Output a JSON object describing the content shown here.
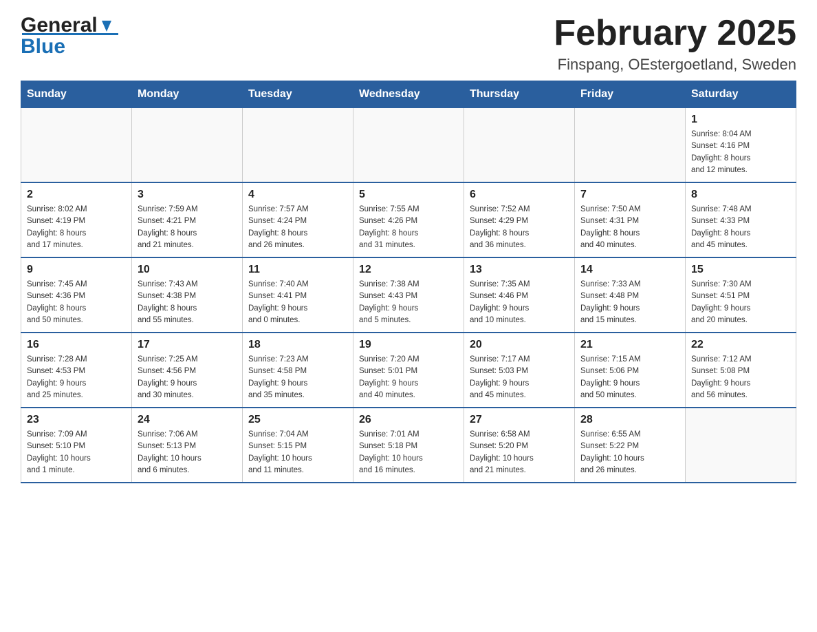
{
  "header": {
    "logo_general": "General",
    "logo_blue": "Blue",
    "month_title": "February 2025",
    "location": "Finspang, OEstergoetland, Sweden"
  },
  "weekdays": [
    "Sunday",
    "Monday",
    "Tuesday",
    "Wednesday",
    "Thursday",
    "Friday",
    "Saturday"
  ],
  "weeks": [
    [
      {
        "day": "",
        "info": ""
      },
      {
        "day": "",
        "info": ""
      },
      {
        "day": "",
        "info": ""
      },
      {
        "day": "",
        "info": ""
      },
      {
        "day": "",
        "info": ""
      },
      {
        "day": "",
        "info": ""
      },
      {
        "day": "1",
        "info": "Sunrise: 8:04 AM\nSunset: 4:16 PM\nDaylight: 8 hours\nand 12 minutes."
      }
    ],
    [
      {
        "day": "2",
        "info": "Sunrise: 8:02 AM\nSunset: 4:19 PM\nDaylight: 8 hours\nand 17 minutes."
      },
      {
        "day": "3",
        "info": "Sunrise: 7:59 AM\nSunset: 4:21 PM\nDaylight: 8 hours\nand 21 minutes."
      },
      {
        "day": "4",
        "info": "Sunrise: 7:57 AM\nSunset: 4:24 PM\nDaylight: 8 hours\nand 26 minutes."
      },
      {
        "day": "5",
        "info": "Sunrise: 7:55 AM\nSunset: 4:26 PM\nDaylight: 8 hours\nand 31 minutes."
      },
      {
        "day": "6",
        "info": "Sunrise: 7:52 AM\nSunset: 4:29 PM\nDaylight: 8 hours\nand 36 minutes."
      },
      {
        "day": "7",
        "info": "Sunrise: 7:50 AM\nSunset: 4:31 PM\nDaylight: 8 hours\nand 40 minutes."
      },
      {
        "day": "8",
        "info": "Sunrise: 7:48 AM\nSunset: 4:33 PM\nDaylight: 8 hours\nand 45 minutes."
      }
    ],
    [
      {
        "day": "9",
        "info": "Sunrise: 7:45 AM\nSunset: 4:36 PM\nDaylight: 8 hours\nand 50 minutes."
      },
      {
        "day": "10",
        "info": "Sunrise: 7:43 AM\nSunset: 4:38 PM\nDaylight: 8 hours\nand 55 minutes."
      },
      {
        "day": "11",
        "info": "Sunrise: 7:40 AM\nSunset: 4:41 PM\nDaylight: 9 hours\nand 0 minutes."
      },
      {
        "day": "12",
        "info": "Sunrise: 7:38 AM\nSunset: 4:43 PM\nDaylight: 9 hours\nand 5 minutes."
      },
      {
        "day": "13",
        "info": "Sunrise: 7:35 AM\nSunset: 4:46 PM\nDaylight: 9 hours\nand 10 minutes."
      },
      {
        "day": "14",
        "info": "Sunrise: 7:33 AM\nSunset: 4:48 PM\nDaylight: 9 hours\nand 15 minutes."
      },
      {
        "day": "15",
        "info": "Sunrise: 7:30 AM\nSunset: 4:51 PM\nDaylight: 9 hours\nand 20 minutes."
      }
    ],
    [
      {
        "day": "16",
        "info": "Sunrise: 7:28 AM\nSunset: 4:53 PM\nDaylight: 9 hours\nand 25 minutes."
      },
      {
        "day": "17",
        "info": "Sunrise: 7:25 AM\nSunset: 4:56 PM\nDaylight: 9 hours\nand 30 minutes."
      },
      {
        "day": "18",
        "info": "Sunrise: 7:23 AM\nSunset: 4:58 PM\nDaylight: 9 hours\nand 35 minutes."
      },
      {
        "day": "19",
        "info": "Sunrise: 7:20 AM\nSunset: 5:01 PM\nDaylight: 9 hours\nand 40 minutes."
      },
      {
        "day": "20",
        "info": "Sunrise: 7:17 AM\nSunset: 5:03 PM\nDaylight: 9 hours\nand 45 minutes."
      },
      {
        "day": "21",
        "info": "Sunrise: 7:15 AM\nSunset: 5:06 PM\nDaylight: 9 hours\nand 50 minutes."
      },
      {
        "day": "22",
        "info": "Sunrise: 7:12 AM\nSunset: 5:08 PM\nDaylight: 9 hours\nand 56 minutes."
      }
    ],
    [
      {
        "day": "23",
        "info": "Sunrise: 7:09 AM\nSunset: 5:10 PM\nDaylight: 10 hours\nand 1 minute."
      },
      {
        "day": "24",
        "info": "Sunrise: 7:06 AM\nSunset: 5:13 PM\nDaylight: 10 hours\nand 6 minutes."
      },
      {
        "day": "25",
        "info": "Sunrise: 7:04 AM\nSunset: 5:15 PM\nDaylight: 10 hours\nand 11 minutes."
      },
      {
        "day": "26",
        "info": "Sunrise: 7:01 AM\nSunset: 5:18 PM\nDaylight: 10 hours\nand 16 minutes."
      },
      {
        "day": "27",
        "info": "Sunrise: 6:58 AM\nSunset: 5:20 PM\nDaylight: 10 hours\nand 21 minutes."
      },
      {
        "day": "28",
        "info": "Sunrise: 6:55 AM\nSunset: 5:22 PM\nDaylight: 10 hours\nand 26 minutes."
      },
      {
        "day": "",
        "info": ""
      }
    ]
  ]
}
